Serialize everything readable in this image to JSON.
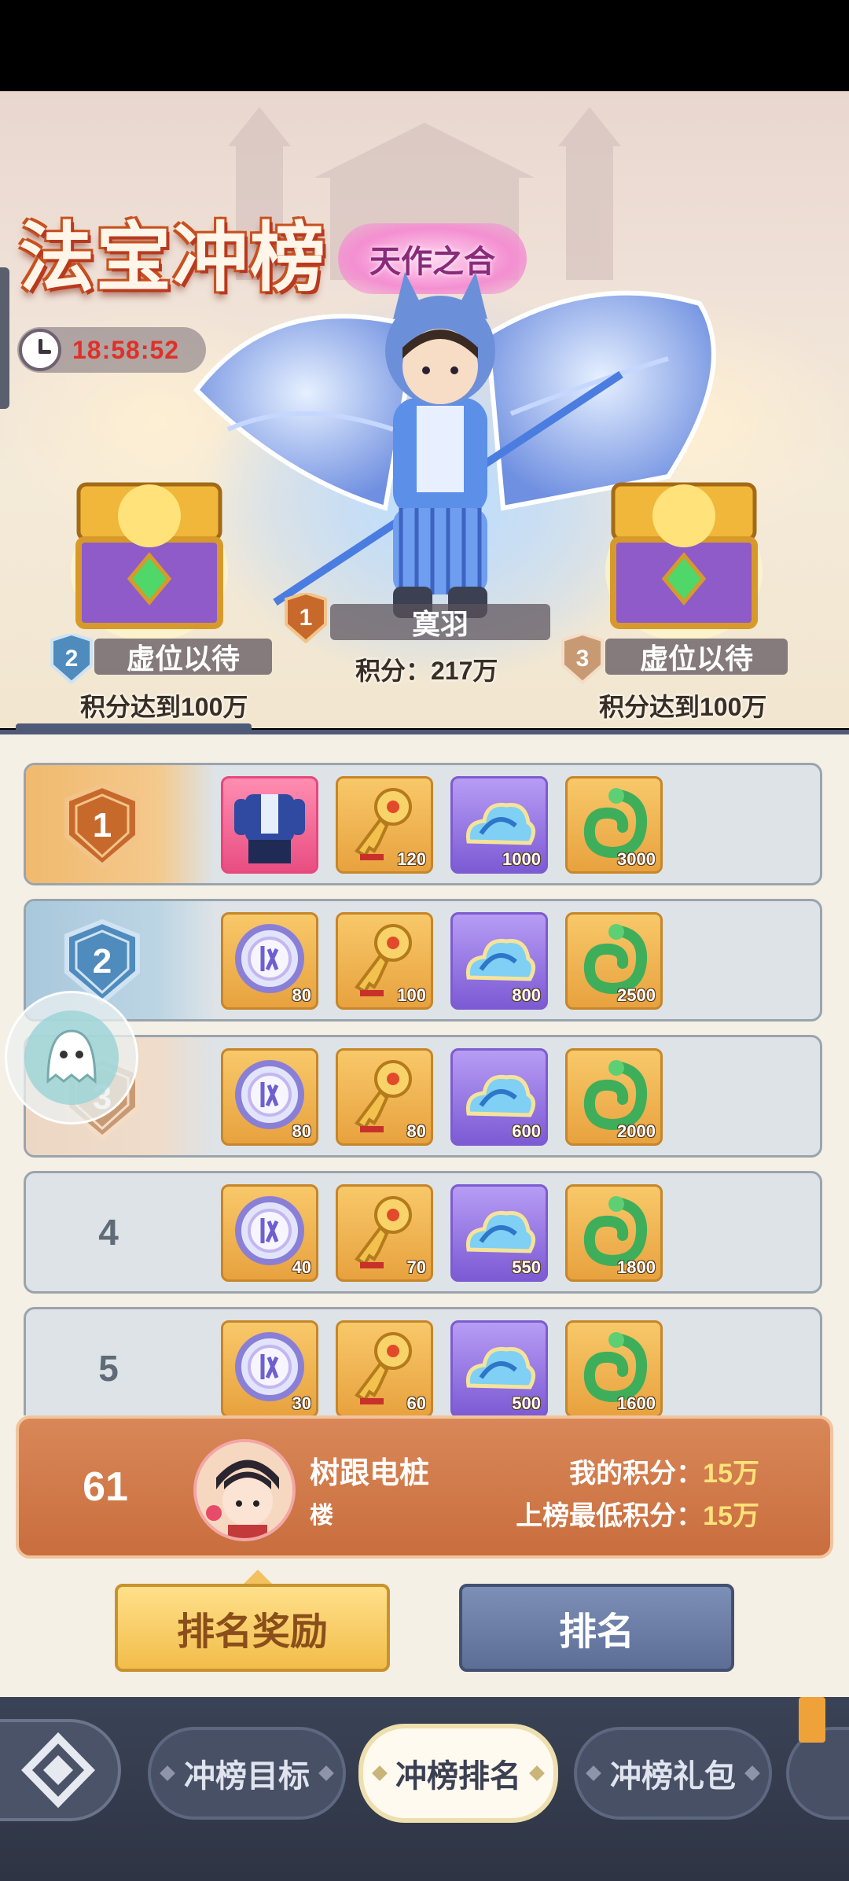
{
  "banner": {
    "title": "法宝冲榜",
    "subtitle": "天作之合",
    "timer": "18:58:52"
  },
  "podium": {
    "first": {
      "rank": "1",
      "name": "寞羽",
      "score_label": "积分：217万"
    },
    "second": {
      "rank": "2",
      "name": "虚位以待",
      "requirement": "积分达到100万"
    },
    "third": {
      "rank": "3",
      "name": "虚位以待",
      "requirement": "积分达到100万"
    }
  },
  "rewards": [
    {
      "rank": "1",
      "items": [
        {
          "icon": "outfit-icon",
          "qty": ""
        },
        {
          "icon": "golden-key-icon",
          "qty": "120"
        },
        {
          "icon": "blue-cloud-icon",
          "qty": "1000"
        },
        {
          "icon": "jade-dragon-icon",
          "qty": "3000"
        }
      ]
    },
    {
      "rank": "2",
      "items": [
        {
          "icon": "spirit-coin-icon",
          "qty": "80"
        },
        {
          "icon": "golden-key-icon",
          "qty": "100"
        },
        {
          "icon": "blue-cloud-icon",
          "qty": "800"
        },
        {
          "icon": "jade-dragon-icon",
          "qty": "2500"
        }
      ]
    },
    {
      "rank": "3",
      "items": [
        {
          "icon": "spirit-coin-icon",
          "qty": "80"
        },
        {
          "icon": "golden-key-icon",
          "qty": "80"
        },
        {
          "icon": "blue-cloud-icon",
          "qty": "600"
        },
        {
          "icon": "jade-dragon-icon",
          "qty": "2000"
        }
      ]
    },
    {
      "rank": "4",
      "items": [
        {
          "icon": "spirit-coin-icon",
          "qty": "40"
        },
        {
          "icon": "golden-key-icon",
          "qty": "70"
        },
        {
          "icon": "blue-cloud-icon",
          "qty": "550"
        },
        {
          "icon": "jade-dragon-icon",
          "qty": "1800"
        }
      ]
    },
    {
      "rank": "5",
      "items": [
        {
          "icon": "spirit-coin-icon",
          "qty": "30"
        },
        {
          "icon": "golden-key-icon",
          "qty": "60"
        },
        {
          "icon": "blue-cloud-icon",
          "qty": "500"
        },
        {
          "icon": "jade-dragon-icon",
          "qty": "1600"
        }
      ]
    }
  ],
  "my_rank": {
    "rank": "61",
    "name_line1": "树跟电桩",
    "name_line2": "楼",
    "score_label": "我的积分：",
    "score_value": "15万",
    "min_label": "上榜最低积分：",
    "min_value": "15万"
  },
  "buttons": {
    "reward": "排名奖励",
    "rank": "排名"
  },
  "tabs": [
    {
      "label": "冲榜目标"
    },
    {
      "label": "冲榜排名",
      "active": true
    },
    {
      "label": "冲榜礼包"
    }
  ],
  "colors": {
    "accent_gold": "#f2bd4a",
    "accent_slate": "#5d6e96",
    "my_bar": "#c96e3e",
    "timer_red": "#e0302a"
  }
}
